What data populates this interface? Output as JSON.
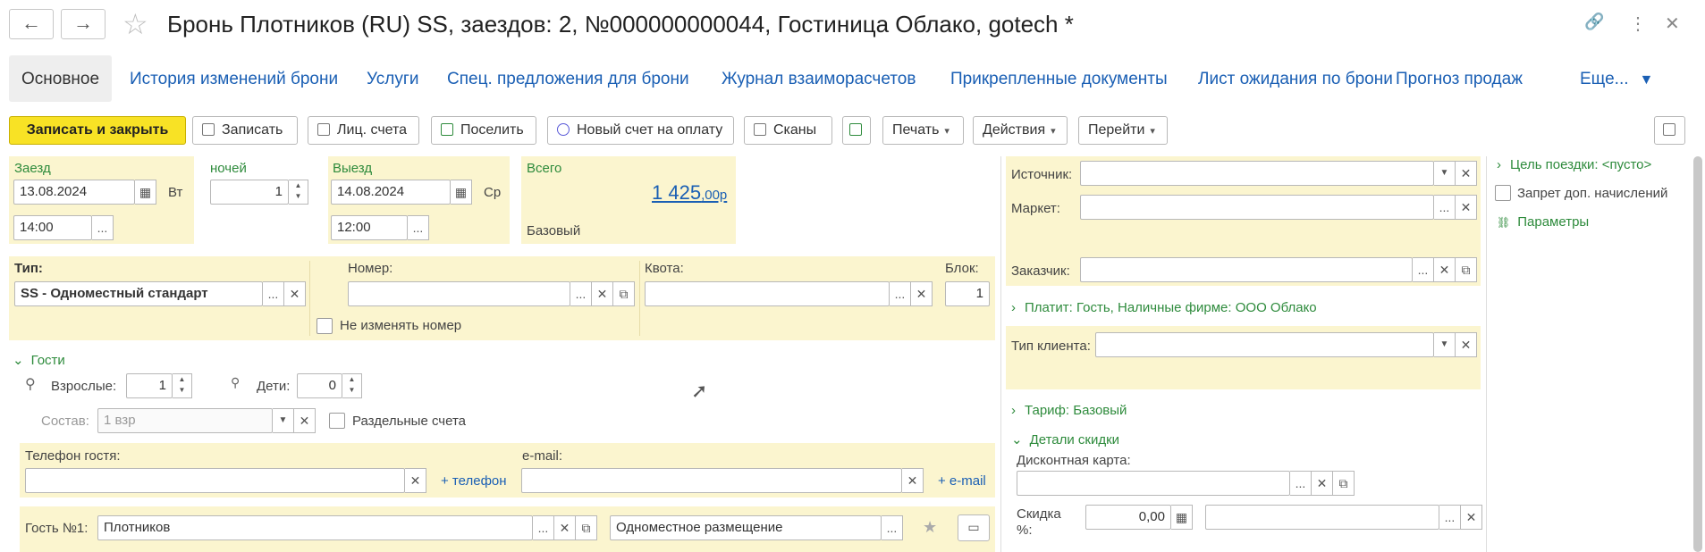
{
  "header": {
    "back_icon": "←",
    "forward_icon": "→",
    "star_icon": "☆",
    "title": "Бронь Плотников (RU) SS, заездов: 2, №000000000044, Гостиница Облако, gotech *",
    "link_icon": "🔗",
    "more_icon": "⋮",
    "close_icon": "✕"
  },
  "tabs": [
    {
      "label": "Основное"
    },
    {
      "label": "История изменений брони"
    },
    {
      "label": "Услуги"
    },
    {
      "label": "Спец. предложения для брони"
    },
    {
      "label": "Журнал взаиморасчетов"
    },
    {
      "label": "Прикрепленные документы"
    },
    {
      "label": "Лист ожидания по брони"
    },
    {
      "label": "Прогноз продаж"
    },
    {
      "label": "Еще..."
    }
  ],
  "toolbar": {
    "save_close": "Записать и закрыть",
    "save": "Записать",
    "accounts": "Лиц. счета",
    "settle": "Поселить",
    "new_invoice": "Новый счет на оплату",
    "scans": "Сканы",
    "print": "Печать",
    "actions": "Действия",
    "goto": "Перейти"
  },
  "stay": {
    "checkin_label": "Заезд",
    "checkin_date": "13.08.2024",
    "checkin_dow": "Вт",
    "checkin_time": "14:00",
    "nights_label": "ночей",
    "nights": "1",
    "checkout_label": "Выезд",
    "checkout_date": "14.08.2024",
    "checkout_dow": "Ср",
    "checkout_time": "12:00",
    "total_label": "Всего",
    "total_main": "1 425",
    "total_cents": ",00р",
    "rate_name": "Базовый"
  },
  "room": {
    "type_label": "Тип:",
    "type_value": "SS - Одноместный стандарт",
    "number_label": "Номер:",
    "quota_label": "Квота:",
    "block_label": "Блок:",
    "block_value": "1",
    "dont_change_label": "Не изменять номер"
  },
  "guests": {
    "section_label": "Гости",
    "adults_label": "Взрослые:",
    "adults": "1",
    "children_label": "Дети:",
    "children": "0",
    "composition_label": "Состав:",
    "composition_value": "1 взр",
    "separate_accounts_label": "Раздельные счета",
    "phone_label": "Телефон гостя:",
    "add_phone": "+ телефон",
    "email_label": "e-mail:",
    "add_email": "+ e-mail",
    "guest1_label": "Гость №1:",
    "guest1_name": "Плотников",
    "guest1_accommodation": "Одноместное размещение"
  },
  "right": {
    "source_label": "Источник:",
    "market_label": "Маркет:",
    "customer_label": "Заказчик:",
    "payer": "Платит: Гость, Наличные фирме: ООО Облако",
    "client_type_label": "Тип клиента:",
    "tariff": "Тариф: Базовый",
    "discount_details": "Детали скидки",
    "discount_card_label": "Дисконтная карта:",
    "discount_label_1": "Скидка",
    "discount_label_2": "%:",
    "discount_value": "0,00"
  },
  "side": {
    "trip_purpose": "Цель поездки: <пусто>",
    "no_extra_charges": "Запрет доп. начислений",
    "parameters": "Параметры"
  }
}
